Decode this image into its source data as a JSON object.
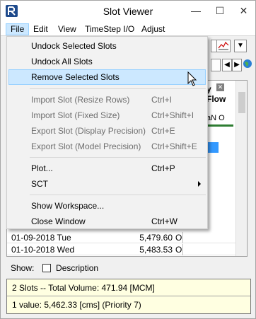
{
  "window": {
    "title": "Slot Viewer",
    "controls": {
      "minimize": "—",
      "maximize": "☐",
      "close": "✕"
    }
  },
  "menubar": [
    {
      "label": "File",
      "active": true
    },
    {
      "label": "Edit"
    },
    {
      "label": "View"
    },
    {
      "label": "TimeStep I/O"
    },
    {
      "label": "Adjust"
    }
  ],
  "file_menu": {
    "items": [
      {
        "label": "Undock Selected Slots",
        "shortcut": "",
        "enabled": true
      },
      {
        "label": "Undock All Slots",
        "shortcut": "",
        "enabled": true
      },
      {
        "label": "Remove Selected Slots",
        "shortcut": "",
        "enabled": true,
        "highlighted": true
      },
      {
        "label": "Import Slot (Resize Rows)",
        "shortcut": "Ctrl+I",
        "enabled": false
      },
      {
        "label": "Import Slot (Fixed Size)",
        "shortcut": "Ctrl+Shift+I",
        "enabled": false
      },
      {
        "label": "Export Slot (Display Precision)",
        "shortcut": "Ctrl+E",
        "enabled": false
      },
      {
        "label": "Export Slot (Model Precision)",
        "shortcut": "Ctrl+Shift+E",
        "enabled": false
      },
      {
        "label": "Plot...",
        "shortcut": "Ctrl+P",
        "enabled": true
      },
      {
        "label": "SCT",
        "shortcut": "",
        "enabled": true,
        "submenu": true
      },
      {
        "label": "Show Workspace...",
        "shortcut": "",
        "enabled": true
      },
      {
        "label": "Close Window",
        "shortcut": "Ctrl+W",
        "enabled": true
      }
    ]
  },
  "grid": {
    "column_header_partial": "y\nFlow",
    "subheader_partial": "aN  O",
    "rows": [
      {
        "date": "01-09-2018 Tue",
        "value": "5,479.60",
        "flag": "O"
      },
      {
        "date": "01-10-2018 Wed",
        "value": "5,483.53",
        "flag": "O"
      }
    ]
  },
  "show": {
    "label": "Show:",
    "checkbox_label": "Description",
    "checked": false
  },
  "status": {
    "line1": "2 Slots -- Total Volume: 471.94 [MCM]",
    "line2": "1 value:  5,462.33 [cms]  (Priority 7)"
  },
  "colors": {
    "menu_highlight": "#cce8ff",
    "selected_cell": "#3399ff",
    "status_bg": "#ffffe1"
  }
}
